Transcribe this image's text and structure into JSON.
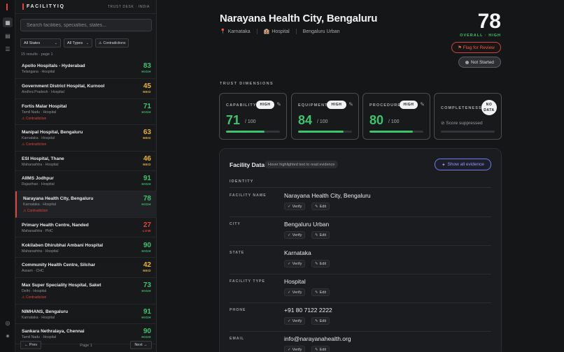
{
  "brand": {
    "name": "FACILITYIQ",
    "desk": "TRUST DESK · INDIA"
  },
  "search": {
    "placeholder": "Search facilities, specialties, states..."
  },
  "filters": {
    "state": "All States",
    "type": "All Types",
    "contradictions": "Contradictions"
  },
  "results_meta": "15 results · page 1",
  "facilities": [
    {
      "name": "Apollo Hospitals - Hyderabad",
      "sub": "Telangana · Hospital",
      "score": "83",
      "level": "HIGH",
      "contradiction": ""
    },
    {
      "name": "Government District Hospital, Kurnool",
      "sub": "Andhra Pradesh · Hospital",
      "score": "45",
      "level": "MED",
      "contradiction": ""
    },
    {
      "name": "Fortis Malar Hospital",
      "sub": "Tamil Nadu · Hospital",
      "score": "71",
      "level": "HIGH",
      "contradiction": "Contradiction"
    },
    {
      "name": "Manipal Hospital, Bengaluru",
      "sub": "Karnataka · Hospital",
      "score": "63",
      "level": "MED",
      "contradiction": "Contradiction"
    },
    {
      "name": "ESI Hospital, Thane",
      "sub": "Maharashtra · Hospital",
      "score": "46",
      "level": "MED",
      "contradiction": ""
    },
    {
      "name": "AIIMS Jodhpur",
      "sub": "Rajasthan · Hospital",
      "score": "91",
      "level": "HIGH",
      "contradiction": ""
    },
    {
      "name": "Narayana Health City, Bengaluru",
      "sub": "Karnataka · Hospital",
      "score": "78",
      "level": "HIGH",
      "contradiction": "Contradiction"
    },
    {
      "name": "Primary Health Centre, Nanded",
      "sub": "Maharashtra · PHC",
      "score": "27",
      "level": "LOW",
      "contradiction": ""
    },
    {
      "name": "Kokilaben Dhirubhai Ambani Hospital",
      "sub": "Maharashtra · Hospital",
      "score": "90",
      "level": "HIGH",
      "contradiction": ""
    },
    {
      "name": "Community Health Centre, Silchar",
      "sub": "Assam · CHC",
      "score": "42",
      "level": "MED",
      "contradiction": ""
    },
    {
      "name": "Max Super Speciality Hospital, Saket",
      "sub": "Delhi · Hospital",
      "score": "73",
      "level": "HIGH",
      "contradiction": "Contradiction"
    },
    {
      "name": "NIMHANS, Bengaluru",
      "sub": "Karnataka · Hospital",
      "score": "91",
      "level": "HIGH",
      "contradiction": ""
    },
    {
      "name": "Sankara Nethralaya, Chennai",
      "sub": "Tamil Nadu · Hospital",
      "score": "90",
      "level": "HIGH",
      "contradiction": ""
    }
  ],
  "pager": {
    "prev": "← Prev",
    "label": "Page 1",
    "next": "Next →"
  },
  "detail": {
    "title": "Narayana Health City, Bengaluru",
    "state": "Karnataka",
    "type": "Hospital",
    "district": "Bengaluru Urban",
    "score": "78",
    "overall": "OVERALL · HIGH",
    "flag_label": "⚑ Flag for Review",
    "status_label": "Not Started"
  },
  "trust_label": "TRUST DIMENSIONS",
  "dimensions": [
    {
      "label": "CAPABILITY",
      "badge": "HIGH",
      "value": "71",
      "denom": "/ 100",
      "fraction": 0.71
    },
    {
      "label": "EQUIPMENT",
      "badge": "HIGH",
      "value": "84",
      "denom": "/ 100",
      "fraction": 0.84
    },
    {
      "label": "PROCEDURE",
      "badge": "HIGH",
      "value": "80",
      "denom": "/ 100",
      "fraction": 0.8
    },
    {
      "label": "COMPLETENESS",
      "badge_line1": "NO",
      "badge_line2": "DATA",
      "note": "Score suppressed"
    }
  ],
  "panel": {
    "title": "Facility Data",
    "hint": "Hover highlighted text to read evidence",
    "show_all": "Show all evidence",
    "section": "IDENTITY",
    "verify": "Verify",
    "edit": "Edit",
    "fields": [
      {
        "label": "FACILITY NAME",
        "value": "Narayana Health City, Bengaluru"
      },
      {
        "label": "CITY",
        "value": "Bengaluru Urban"
      },
      {
        "label": "STATE",
        "value": "Karnataka"
      },
      {
        "label": "FACILITY TYPE",
        "value": "Hospital"
      },
      {
        "label": "PHONE",
        "value": "+91 80 7122 2222"
      },
      {
        "label": "EMAIL",
        "value": "info@narayanahealth.org"
      }
    ]
  },
  "colors": {
    "accent": "#e0443a",
    "green": "#3ec46d",
    "yellow": "#e9b23a",
    "blue": "#8f9cff"
  }
}
